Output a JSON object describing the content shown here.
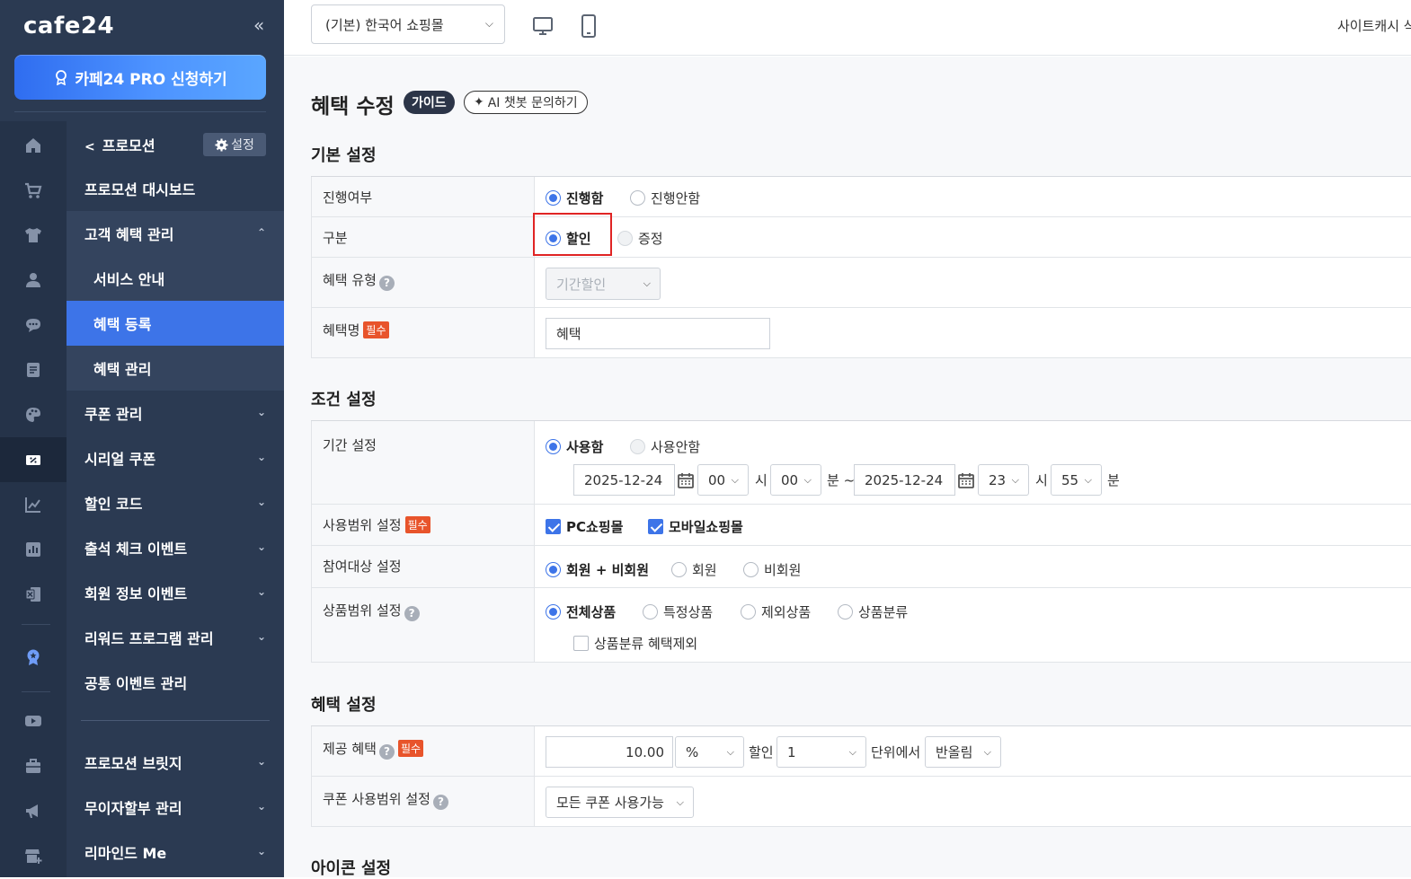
{
  "sidebar": {
    "logo": "cafe24",
    "collapse": "«",
    "pro_button": "카페24 PRO 신청하기",
    "rail_icons": [
      "home-icon",
      "cart-icon",
      "shirt-icon",
      "user-icon",
      "chat-icon",
      "document-icon",
      "palette-icon",
      "coupon-icon",
      "chart-line-icon",
      "chart-bar-icon",
      "excel-icon",
      "badge-icon",
      "video-icon",
      "toolbox-icon",
      "megaphone-icon",
      "add-store-icon"
    ],
    "menu_header": {
      "back_label": "프로모션",
      "settings_label": "설정"
    },
    "items": [
      {
        "label": "프로모션 대시보드"
      },
      {
        "label": "고객 혜택 관리",
        "chevron": "⌃"
      },
      {
        "label": "서비스 안내"
      },
      {
        "label": "혜택 등록"
      },
      {
        "label": "혜택 관리"
      },
      {
        "label": "쿠폰 관리",
        "chevron": "⌄"
      },
      {
        "label": "시리얼 쿠폰",
        "chevron": "⌄"
      },
      {
        "label": "할인 코드",
        "chevron": "⌄"
      },
      {
        "label": "출석 체크 이벤트",
        "chevron": "⌄"
      },
      {
        "label": "회원 정보 이벤트",
        "chevron": "⌄"
      },
      {
        "label": "리워드 프로그램 관리",
        "chevron": "⌄"
      },
      {
        "label": "공통 이벤트 관리"
      },
      {
        "label": "프로모션 브릿지",
        "chevron": "⌄"
      },
      {
        "label": "무이자할부 관리",
        "chevron": "⌄"
      },
      {
        "label": "리마인드 Me",
        "chevron": "⌄"
      }
    ]
  },
  "topbar": {
    "shop_select": "(기본) 한국어 쇼핑몰",
    "right_text": "사이트캐시 삭"
  },
  "page": {
    "title": "혜택 수정",
    "guide_badge": "가이드",
    "ai_badge": "AI 챗봇 문의하기"
  },
  "basic": {
    "title": "기본 설정",
    "progress_label": "진행여부",
    "progress_on": "진행함",
    "progress_off": "진행안함",
    "type_label": "구분",
    "type_discount": "할인",
    "type_gift": "증정",
    "benefit_type_label": "혜택 유형",
    "benefit_type_value": "기간할인",
    "benefit_name_label": "혜택명",
    "benefit_name_value": "혜택",
    "required": "필수"
  },
  "condition": {
    "title": "조건 설정",
    "period_label": "기간 설정",
    "period_use": "사용함",
    "period_nouse": "사용안함",
    "start_date": "2025-12-24",
    "start_hour": "00",
    "start_min": "00",
    "end_date": "2025-12-24",
    "end_hour": "23",
    "end_min": "55",
    "hour_unit": "시",
    "min_unit": "분",
    "range_sep": "분 ~",
    "scope_label": "사용범위 설정",
    "scope_pc": "PC쇼핑몰",
    "scope_mobile": "모바일쇼핑몰",
    "target_label": "참여대상 설정",
    "target_all": "회원 + 비회원",
    "target_member": "회원",
    "target_guest": "비회원",
    "product_label": "상품범위 설정",
    "product_all": "전체상품",
    "product_specific": "특정상품",
    "product_exclude": "제외상품",
    "product_category": "상품분류",
    "exclude_category": "상품분류 혜택제외"
  },
  "benefit": {
    "title": "혜택 설정",
    "offer_label": "제공 혜택",
    "amount": "10.00",
    "unit": "%",
    "discount_text": "할인",
    "round_unit": "1",
    "unit_text": "단위에서",
    "round_mode": "반올림",
    "coupon_label": "쿠폰 사용범위 설정",
    "coupon_value": "모든 쿠폰 사용가능"
  },
  "icon_section": {
    "title": "아이콘 설정"
  }
}
